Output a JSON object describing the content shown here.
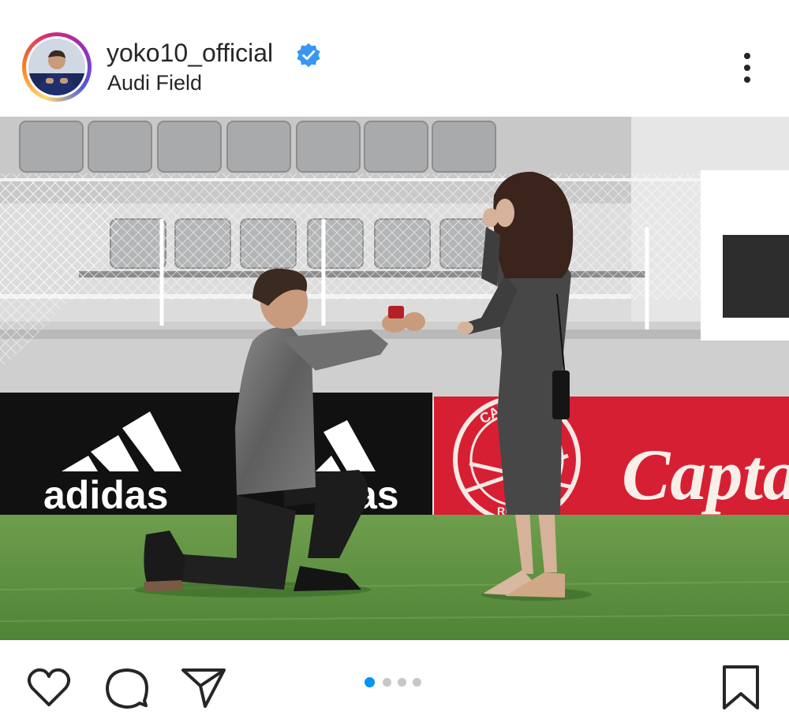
{
  "post": {
    "username": "yoko10_official",
    "location": "Audi Field",
    "verified": true,
    "carousel": {
      "total": 4,
      "active_index": 0
    }
  },
  "photo_text": {
    "sponsor_left": "adidas",
    "sponsor_mid": "as",
    "sponsor_right": "Capta",
    "ring_text_top": "CAPTA",
    "ring_text_bottom": "RUM"
  },
  "colors": {
    "accent_blue": "#0095f6",
    "verified_blue": "#3897f0",
    "dot_inactive": "#c7c7c7",
    "captain_red": "#d71f33"
  },
  "icons": {
    "like": "heart-icon",
    "comment": "comment-icon",
    "share": "send-icon",
    "save": "bookmark-icon",
    "more": "more-options-icon"
  }
}
